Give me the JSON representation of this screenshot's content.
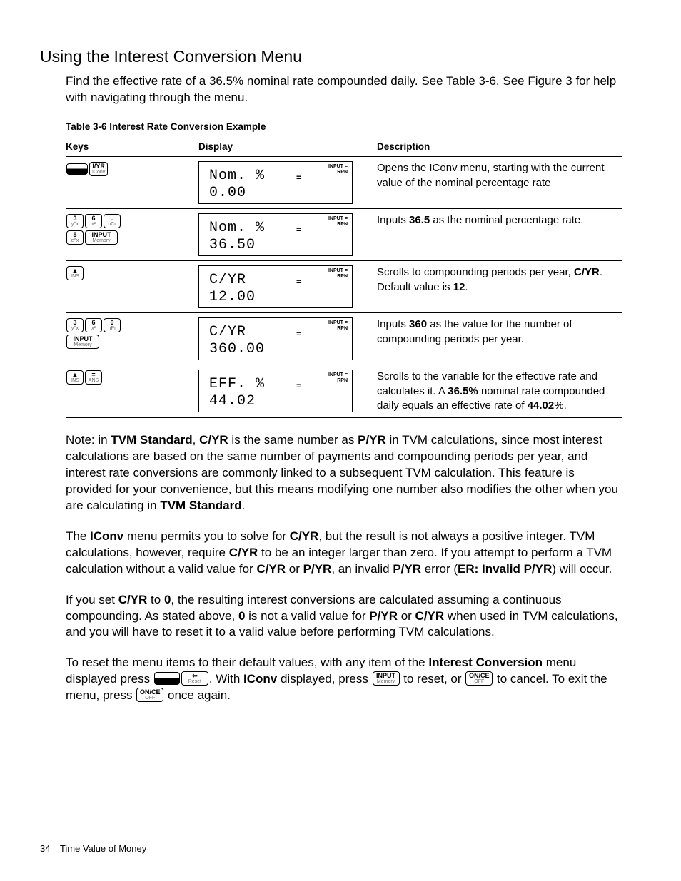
{
  "section_title": "Using the Interest Conversion Menu",
  "intro": "Find the effective rate of a 36.5% nominal rate compounded daily. See Table 3-6. See Figure 3 for help with navigating through the menu.",
  "table_caption": "Table 3-6  Interest Rate Conversion Example",
  "headers": {
    "keys": "Keys",
    "display": "Display",
    "description": "Description"
  },
  "lcd_annun_top": "INPUT  =",
  "lcd_annun_bot": "RPN",
  "lcd_eq": "=",
  "rows": [
    {
      "keys": [
        {
          "type": "shift"
        },
        {
          "type": "dual",
          "top": "I/YR",
          "bot": "IConv"
        }
      ],
      "lcd1": "Nom. %",
      "lcd2": "0.00",
      "desc_html": "Opens the IConv menu, starting with the current value of the nominal percentage rate"
    },
    {
      "keys": [
        {
          "type": "dual",
          "top": "3",
          "bot": "y^x"
        },
        {
          "type": "dual",
          "top": "6",
          "bot": "x²"
        },
        {
          "type": "dual",
          "top": ".",
          "bot": "nCr"
        },
        {
          "br": true
        },
        {
          "type": "dual",
          "top": "5",
          "bot": "e^x"
        },
        {
          "type": "dual",
          "top": "INPUT",
          "bot": "Memory",
          "wide": true
        }
      ],
      "lcd1": "Nom. %",
      "lcd2": "36.50",
      "desc_html": "Inputs <b>36.5</b> as the nominal percentage rate."
    },
    {
      "keys": [
        {
          "type": "dual",
          "top": "▲",
          "bot": "INS"
        }
      ],
      "lcd1": "C/YR",
      "lcd2": "12.00",
      "desc_html": "Scrolls to compounding periods per year, <b>C/YR</b>. Default value is <b>12</b>."
    },
    {
      "keys": [
        {
          "type": "dual",
          "top": "3",
          "bot": "y^x"
        },
        {
          "type": "dual",
          "top": "6",
          "bot": "x²"
        },
        {
          "type": "dual",
          "top": "0",
          "bot": "nPr"
        },
        {
          "br": true
        },
        {
          "type": "dual",
          "top": "INPUT",
          "bot": "Memory",
          "wide": true
        }
      ],
      "lcd1": "C/YR",
      "lcd2": "360.00",
      "desc_html": "Inputs <b>360</b> as the value for the number of compounding periods per year."
    },
    {
      "keys": [
        {
          "type": "dual",
          "top": "▲",
          "bot": "INS"
        },
        {
          "type": "dual",
          "top": "=",
          "bot": "ANS"
        }
      ],
      "lcd1": "EFF. %",
      "lcd2": "44.02",
      "desc_html": "Scrolls to the variable for the effective rate and calculates it. A <b>36.5%</b> nominal rate compounded daily equals an effective rate of <b>44.02</b>%."
    }
  ],
  "para1": "Note: in <b>TVM Standard</b>, <b>C/YR</b> is the same number as <b>P/YR</b> in TVM calculations, since most interest calculations are based on the same number of payments and compounding periods per year, and interest rate conversions are commonly linked to a subsequent TVM calculation. This feature is provided for your convenience, but this means modifying one number also modifies the other when you are calculating in <b>TVM Standard</b>.",
  "para2": "The <b>IConv</b> menu permits you to solve for <b>C/YR</b>, but the result is not always a positive integer. TVM calculations, however, require <b>C/YR</b> to be an integer larger than zero. If you attempt to perform a TVM calculation without a valid value for <b>C/YR</b> or <b>P/YR</b>, an invalid <b>P/YR</b> error (<b>ER: Invalid P/YR</b>) will occur.",
  "para3": "If you set <b>C/YR</b> to <b>0</b>, the resulting interest conversions are calculated assuming a continuous compounding. As stated above, <b>0</b> is not a valid value for <b>P/YR</b> or <b>C/YR</b> when used in TVM calculations, and you will have to reset it to a valid value before performing TVM calculations.",
  "para4_a": "To reset the menu items to their default values, with any item of the <b>Interest Conversion</b> menu displayed press ",
  "para4_b": ". With <b>IConv</b> displayed, press ",
  "para4_c": " to reset, or ",
  "para4_d": " to cancel. To exit the menu, press ",
  "para4_e": " once again.",
  "inline_keys": {
    "shift": {
      "type": "shift"
    },
    "reset": {
      "top": "⇦",
      "bot": "Reset"
    },
    "input": {
      "top": "INPUT",
      "bot": "Memory"
    },
    "once1": {
      "top": "ON/CE",
      "bot": "OFF"
    },
    "once2": {
      "top": "ON/CE",
      "bot": "OFF"
    }
  },
  "footer_page": "34",
  "footer_title": "Time Value of Money"
}
